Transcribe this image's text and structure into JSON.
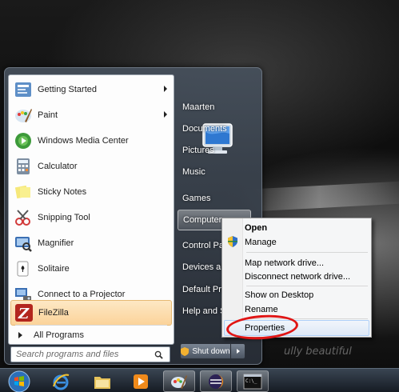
{
  "desktop": {
    "tagline": "ully beautiful"
  },
  "start_menu": {
    "pinned": [
      {
        "label": "Getting Started",
        "icon": "getting-started-icon",
        "has_submenu": true
      },
      {
        "label": "Paint",
        "icon": "paint-icon",
        "has_submenu": true
      },
      {
        "label": "Windows Media Center",
        "icon": "media-center-icon",
        "has_submenu": false
      },
      {
        "label": "Calculator",
        "icon": "calculator-icon",
        "has_submenu": false
      },
      {
        "label": "Sticky Notes",
        "icon": "sticky-notes-icon",
        "has_submenu": false
      },
      {
        "label": "Snipping Tool",
        "icon": "snipping-tool-icon",
        "has_submenu": false
      },
      {
        "label": "Magnifier",
        "icon": "magnifier-icon",
        "has_submenu": false
      },
      {
        "label": "Solitaire",
        "icon": "solitaire-icon",
        "has_submenu": false
      },
      {
        "label": "Connect to a Projector",
        "icon": "projector-icon",
        "has_submenu": false
      },
      {
        "label": "FileZilla",
        "icon": "filezilla-icon",
        "has_submenu": false,
        "highlighted": true
      }
    ],
    "all_programs_label": "All Programs",
    "search": {
      "placeholder": "Search programs and files"
    },
    "right_items": [
      {
        "label": "Maarten"
      },
      {
        "label": "Documents"
      },
      {
        "label": "Pictures"
      },
      {
        "label": "Music"
      },
      {
        "label": "Games"
      },
      {
        "label": "Computer",
        "active": true
      },
      {
        "label": "Control Pan"
      },
      {
        "label": "Devices and"
      },
      {
        "label": "Default Prog"
      },
      {
        "label": "Help and Su"
      }
    ],
    "shutdown_label": "Shut down"
  },
  "context_menu": {
    "items": [
      {
        "label": "Open",
        "bold": true
      },
      {
        "label": "Manage",
        "icon": "uac-shield-icon"
      },
      {
        "label": "Map network drive..."
      },
      {
        "label": "Disconnect network drive..."
      },
      {
        "label": "Show on Desktop"
      },
      {
        "label": "Rename"
      },
      {
        "label": "Properties",
        "highlighted": true
      }
    ]
  },
  "taskbar": {
    "buttons": [
      {
        "name": "start-orb",
        "icon": "windows-orb-icon"
      },
      {
        "name": "internet-explorer",
        "icon": "internet-explorer-icon"
      },
      {
        "name": "windows-explorer",
        "icon": "folder-icon"
      },
      {
        "name": "media-player",
        "icon": "media-player-icon"
      },
      {
        "name": "paint",
        "icon": "paint-icon",
        "active": true
      },
      {
        "name": "eclipse",
        "icon": "eclipse-icon",
        "active": true
      },
      {
        "name": "command-prompt",
        "icon": "command-prompt-icon",
        "active": true
      }
    ]
  },
  "colors": {
    "highlight_red": "#e01515",
    "hover_orange": "#fbd39a",
    "menu_selection_blue": "#aecff7"
  }
}
